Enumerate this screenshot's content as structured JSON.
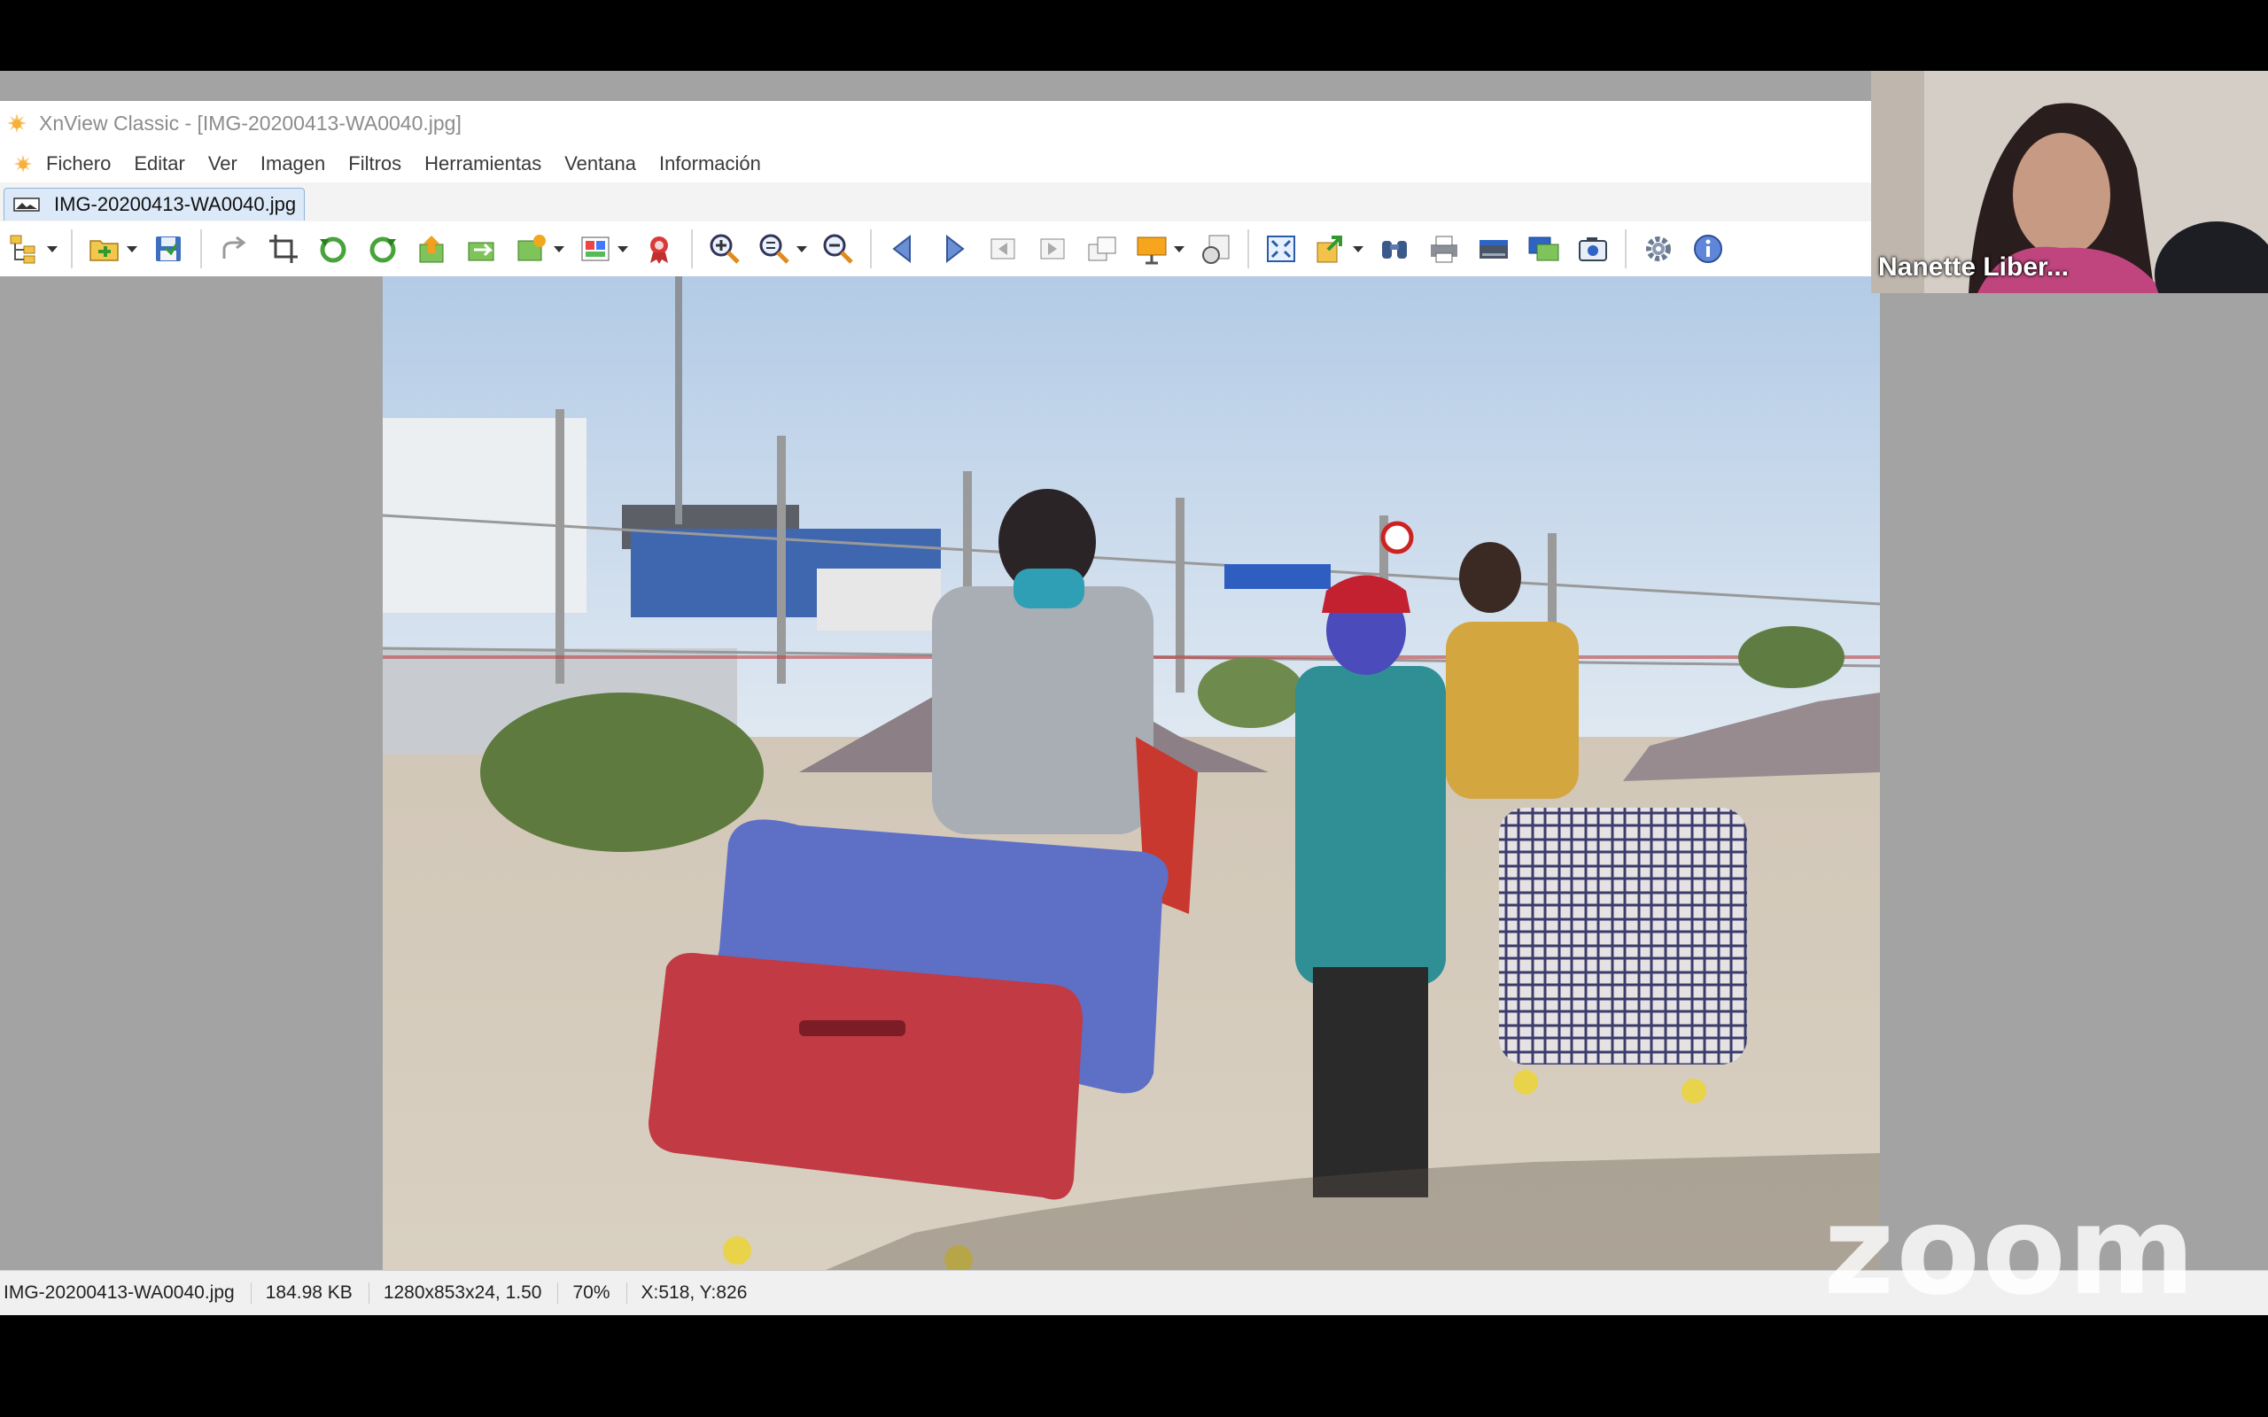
{
  "window": {
    "title": "XnView Classic - [IMG-20200413-WA0040.jpg]"
  },
  "menu": [
    "Fichero",
    "Editar",
    "Ver",
    "Imagen",
    "Filtros",
    "Herramientas",
    "Ventana",
    "Información"
  ],
  "tab": {
    "label": "IMG-20200413-WA0040.jpg"
  },
  "toolbar": {
    "icons": [
      "browser-tree-icon",
      "open-folder-icon",
      "save-icon",
      "undo-icon",
      "crop-icon",
      "rotate-left-icon",
      "rotate-right-icon",
      "export-icon",
      "convert-icon",
      "image-edit-icon",
      "adjust-icon",
      "award-icon",
      "zoom-in-icon",
      "zoom-fit-icon",
      "zoom-out-icon",
      "arrow-left-icon",
      "arrow-right-icon",
      "first-page-icon",
      "last-page-icon",
      "pages-icon",
      "slideshow-icon",
      "capture-icon",
      "fullscreen-icon",
      "copy-to-icon",
      "find-icon",
      "print-icon",
      "scanner-icon",
      "wallpaper-icon",
      "camera-icon",
      "settings-icon",
      "info-icon"
    ]
  },
  "status": {
    "filename": "IMG-20200413-WA0040.jpg",
    "filesize": "184.98 KB",
    "dimensions": "1280x853x24, 1.50",
    "zoom": "70%",
    "cursor": "X:518, Y:826"
  },
  "participant": {
    "name": "Nanette Liber..."
  },
  "zoom_logo": "zoom",
  "colors": {
    "accent": "#2b7bd6",
    "panel": "#a3a3a3",
    "sky": "#c8d9ea"
  }
}
